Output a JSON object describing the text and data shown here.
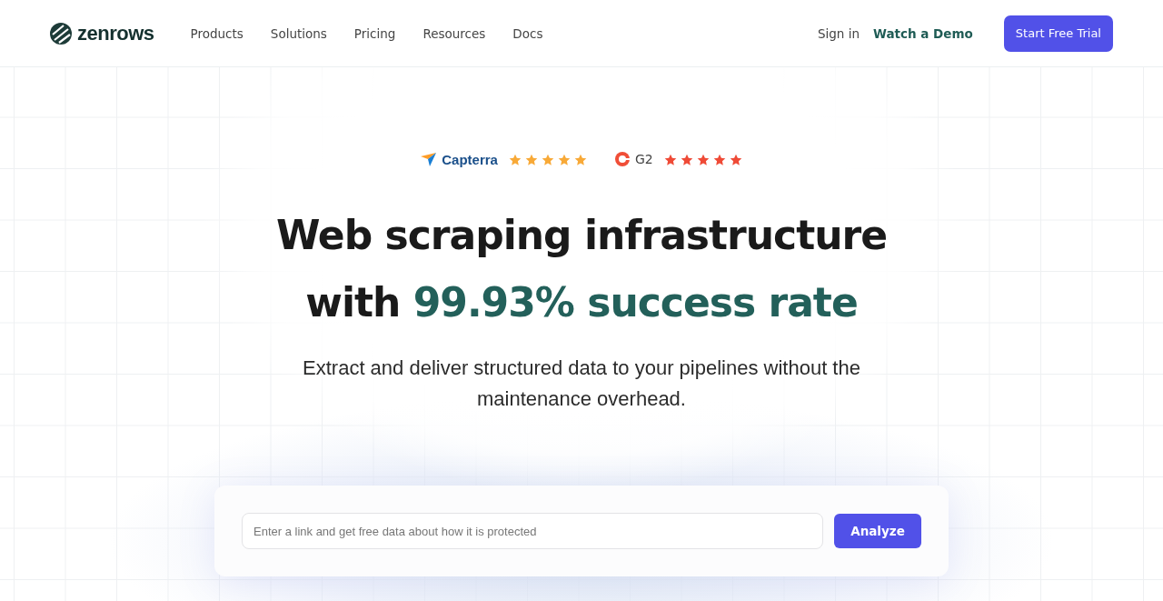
{
  "header": {
    "logo": "zenrows",
    "nav": [
      "Products",
      "Solutions",
      "Pricing",
      "Resources",
      "Docs"
    ],
    "sign_in": "Sign in",
    "demo": "Watch a Demo",
    "cta": "Start Free Trial"
  },
  "ratings": [
    {
      "kind": "capterra",
      "label": "Capterra",
      "stars": 5
    },
    {
      "kind": "g2",
      "label": "G2",
      "stars": 5
    }
  ],
  "headline": {
    "line_1": "Web scraping infrastructure",
    "line_2": "with",
    "highlight": "99.93% success rate"
  },
  "subtitle": "Extract and deliver structured data to your pipelines without the maintenance overhead.",
  "analyze": {
    "placeholder": "Enter a link and get free data about how it is protected",
    "button": "Analyze"
  }
}
